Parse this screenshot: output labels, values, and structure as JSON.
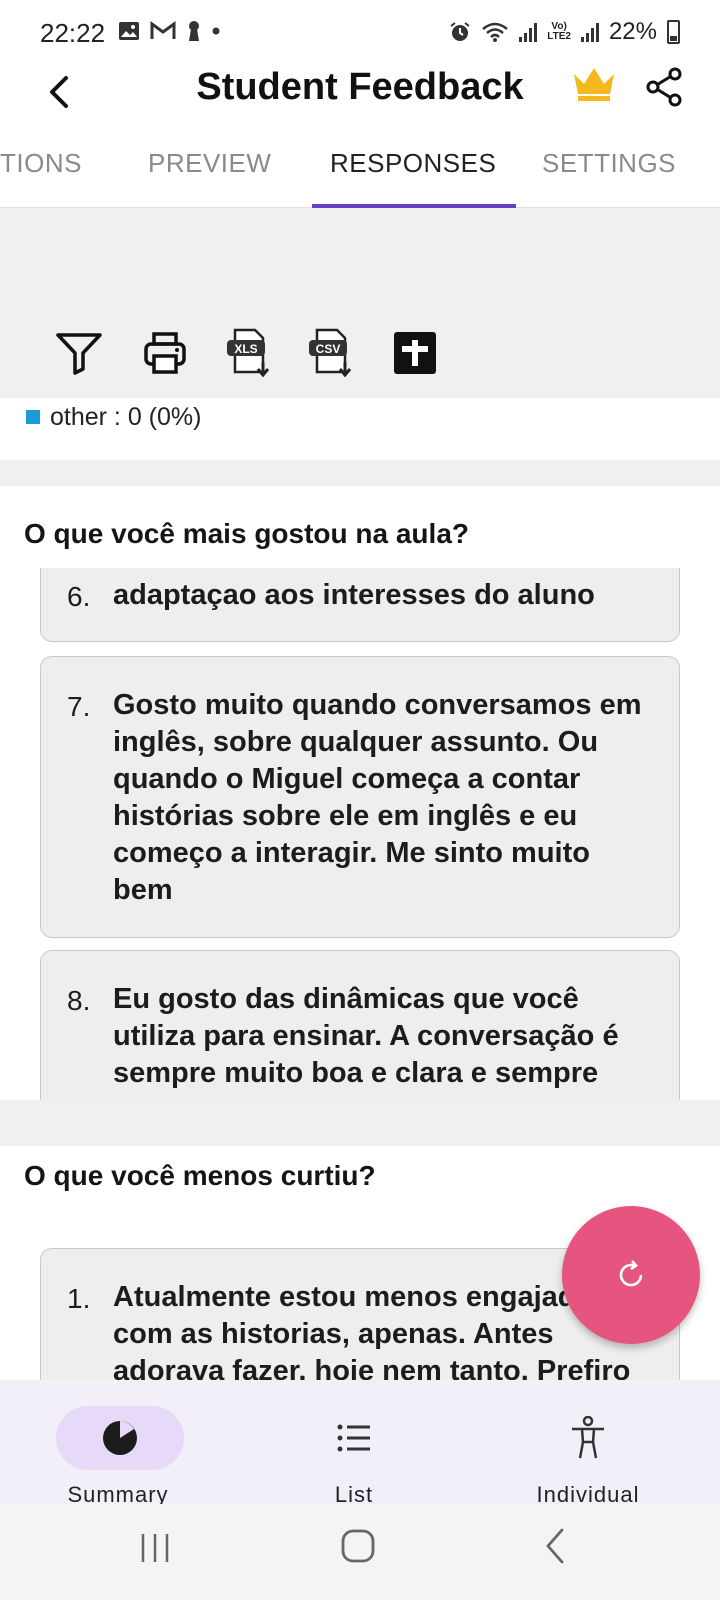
{
  "status_bar": {
    "time": "22:22",
    "battery": "22%"
  },
  "app_bar": {
    "title": "Student Feedback"
  },
  "tabs": [
    {
      "label": "TIONS"
    },
    {
      "label": "PREVIEW"
    },
    {
      "label": "RESPONSES"
    },
    {
      "label": "SETTINGS"
    }
  ],
  "toolbar": {
    "xls_label": "XLS",
    "csv_label": "CSV"
  },
  "summary": {
    "legend_text": "other : 0 (0%)",
    "legend_color": "#1a9ad6"
  },
  "questions": [
    {
      "title": "O que você mais gostou na aula?",
      "answers": [
        {
          "num": "6.",
          "text": "adaptaçao aos interesses do aluno"
        },
        {
          "num": "7.",
          "text": "Gosto muito quando conversamos em inglês, sobre qualquer assunto. Ou quando o Miguel começa a contar histórias sobre ele em inglês e eu começo a interagir. Me sinto muito bem"
        },
        {
          "num": "8.",
          "text": "Eu gosto das dinâmicas que você utiliza para ensinar. A conversação é sempre muito boa e clara e sempre"
        }
      ]
    },
    {
      "title": "O que você menos curtiu?",
      "answers": [
        {
          "num": "1.",
          "text": "Atualmente estou menos engajado com as historias, apenas. Antes adorava fazer, hoje nem tanto. Prefiro"
        }
      ]
    }
  ],
  "bottom_nav": [
    {
      "label": "Summary"
    },
    {
      "label": "List"
    },
    {
      "label": "Individual"
    }
  ],
  "colors": {
    "accent": "#6a3fc4",
    "fab": "#e5557f",
    "crown": "#f5b91e"
  }
}
